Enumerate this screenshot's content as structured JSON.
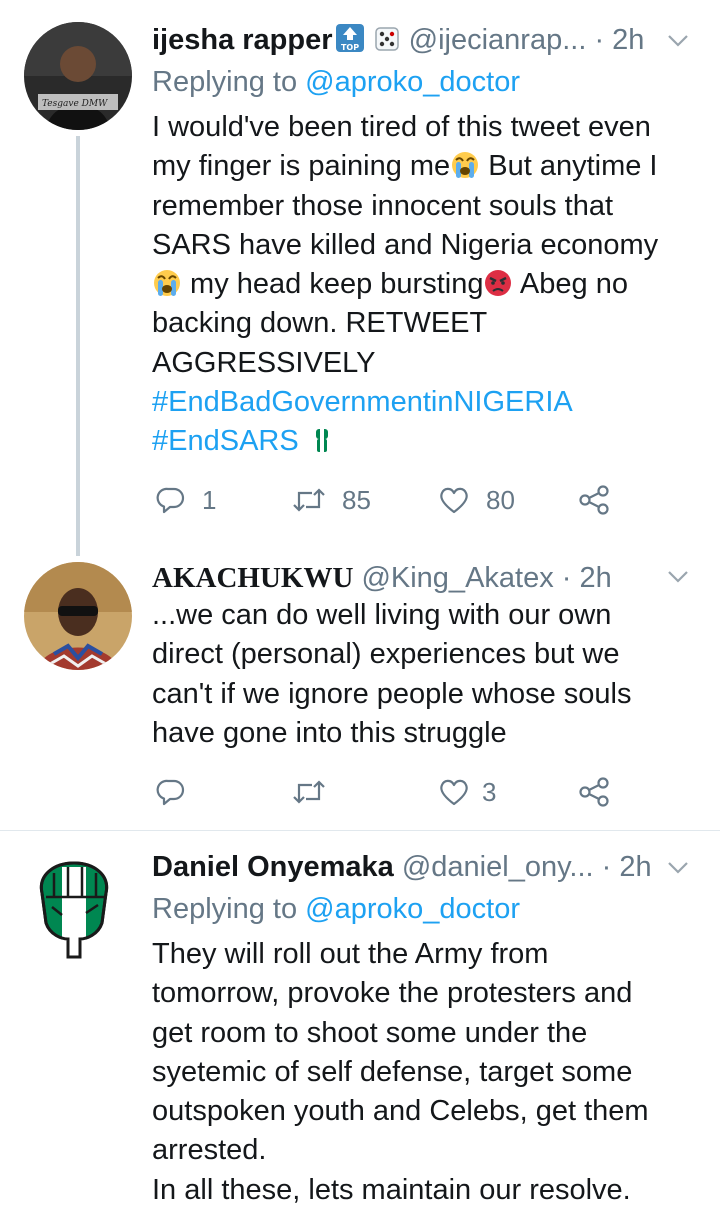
{
  "tweets": [
    {
      "name": "ijesha rapper",
      "handle": "@ijecianrap...",
      "time": "· 2h",
      "replying_prefix": "Replying to ",
      "replying_to": "@aproko_doctor",
      "text_line1": "I would've been tired of this tweet even",
      "text_line2a": "my finger is paining me",
      "text_line2b": " But anytime I",
      "text_line3": "remember those innocent souls that",
      "text_line4": "SARS have killed and Nigeria economy",
      "text_line5a": " my head keep bursting",
      "text_line5b": " Abeg no",
      "text_line6": "backing down. RETWEET",
      "text_line7": "AGGRESSIVELY",
      "hashtag1": "#EndBadGovernmentinNIGERIA",
      "hashtag2": "#EndSARS",
      "replies": "1",
      "retweets": "85",
      "likes": "80"
    },
    {
      "name": "AKACHUKWU",
      "handle": "@King_Akatex",
      "time": "· 2h",
      "text_line1": "...we can do well living with our own",
      "text_line2": "direct (personal) experiences but we",
      "text_line3": "can't if we ignore people whose souls",
      "text_line4": "have gone into this struggle",
      "replies": "",
      "retweets": "",
      "likes": "3"
    },
    {
      "name": "Daniel Onyemaka",
      "handle": "@daniel_ony...",
      "time": "· 2h",
      "replying_prefix": "Replying to ",
      "replying_to": "@aproko_doctor",
      "text_line1": "They will roll out the Army from",
      "text_line2": "tomorrow, provoke the protesters and",
      "text_line3": "get room to shoot some under the",
      "text_line4": "syetemic of self defense,  target some",
      "text_line5": "outspoken youth and Celebs, get them",
      "text_line6": "arrested.",
      "text_line7": "In all these, lets maintain our resolve."
    }
  ],
  "colors": {
    "link": "#1da1f2",
    "muted": "#657786",
    "divider": "#e1e8ed",
    "thread": "#c9d3da"
  },
  "icons": [
    "reply-icon",
    "retweet-icon",
    "like-icon",
    "share-icon",
    "chevron-down-icon",
    "top-emoji-icon",
    "dice-emoji-icon",
    "crying-emoji-icon",
    "angry-emoji-icon",
    "raised-fist-emoji-icon"
  ]
}
